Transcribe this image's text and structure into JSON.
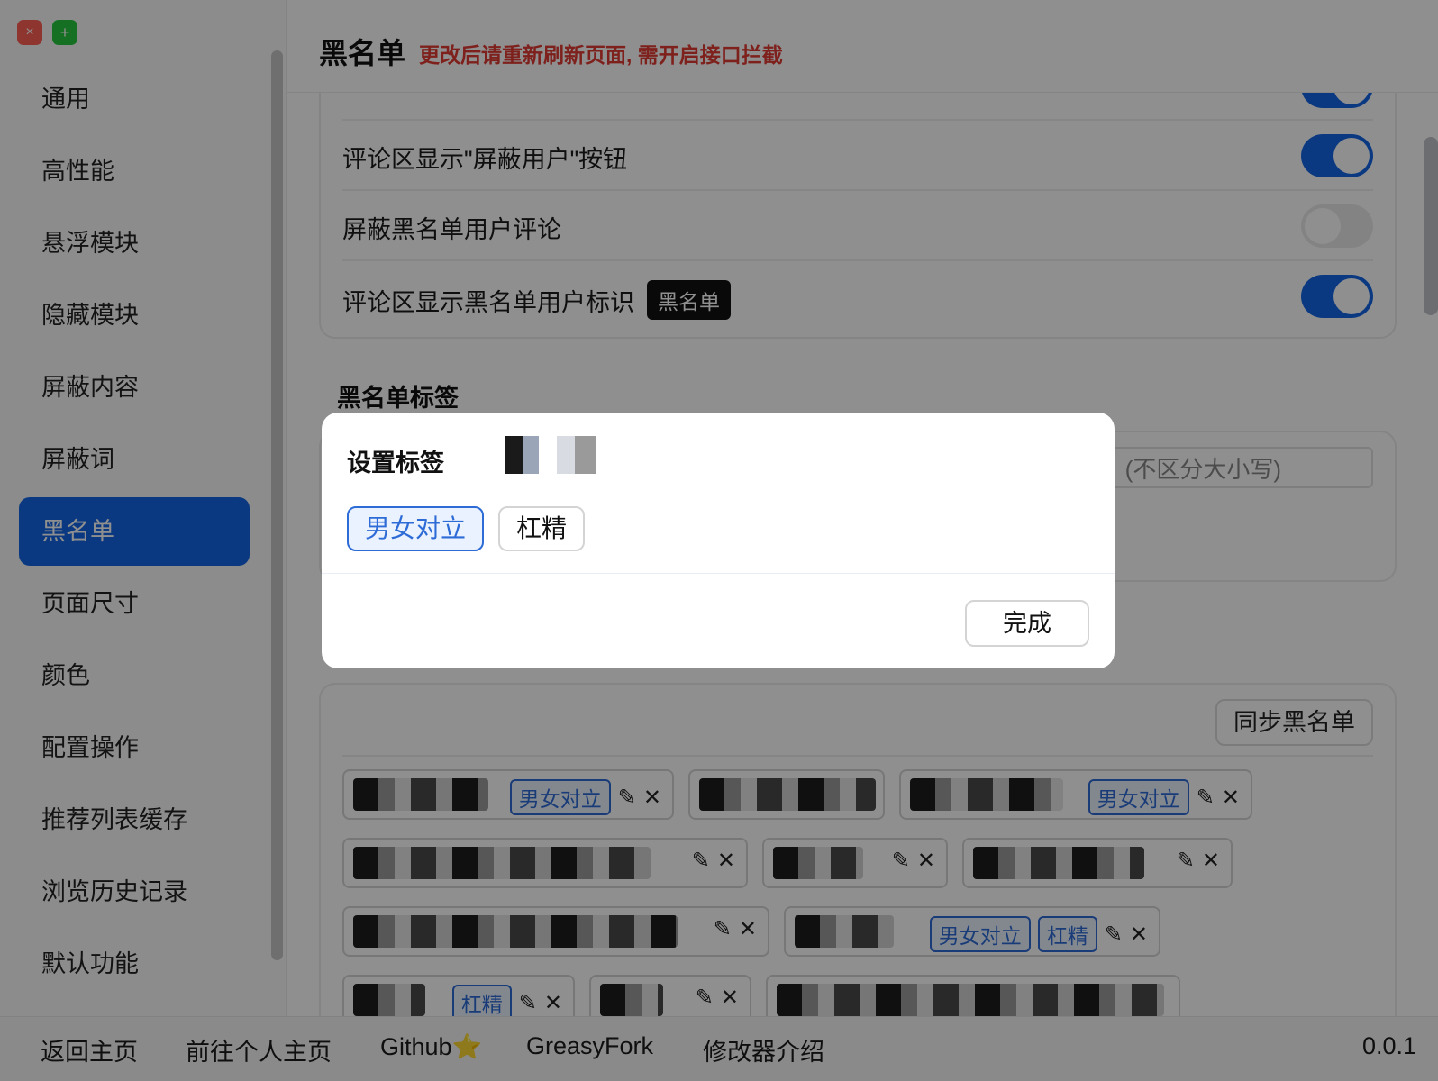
{
  "window": {
    "close_icon": "×",
    "add_icon": "+"
  },
  "sidebar": {
    "items": [
      {
        "label": "通用"
      },
      {
        "label": "高性能"
      },
      {
        "label": "悬浮模块"
      },
      {
        "label": "隐藏模块"
      },
      {
        "label": "屏蔽内容"
      },
      {
        "label": "屏蔽词"
      },
      {
        "label": "黑名单",
        "active": true
      },
      {
        "label": "页面尺寸"
      },
      {
        "label": "颜色"
      },
      {
        "label": "配置操作"
      },
      {
        "label": "推荐列表缓存"
      },
      {
        "label": "浏览历史记录"
      },
      {
        "label": "默认功能"
      }
    ]
  },
  "header": {
    "title": "黑名单",
    "warning": "更改后请重新刷新页面, 需开启接口拦截"
  },
  "settings": {
    "rows": [
      {
        "label": "评论区显示\"屏蔽用户\"按钮",
        "enabled": true
      },
      {
        "label": "屏蔽黑名单用户评论",
        "enabled": false
      },
      {
        "label": "评论区显示黑名单用户标识",
        "enabled": true,
        "tag": "黑名单"
      }
    ]
  },
  "section": {
    "title": "黑名单标签",
    "search_placeholder_visible": "(不区分大小写)"
  },
  "blacklist": {
    "sync_button": "同步黑名单",
    "tags": {
      "t1": "男女对立",
      "t2": "杠精"
    },
    "edit_icon": "✎",
    "remove_icon": "✕"
  },
  "modal": {
    "title": "设置标签",
    "tags": [
      {
        "label": "男女对立",
        "selected": true
      },
      {
        "label": "杠精",
        "selected": false
      }
    ],
    "done_button": "完成"
  },
  "footer": {
    "links": [
      "返回主页",
      "前往个人主页",
      "Github⭐",
      "GreasyFork",
      "修改器介绍"
    ],
    "version": "0.0.1"
  },
  "colors": {
    "accent": "#1466e6",
    "warning": "#e03a32",
    "tag_blue": "#2d6bd6"
  }
}
